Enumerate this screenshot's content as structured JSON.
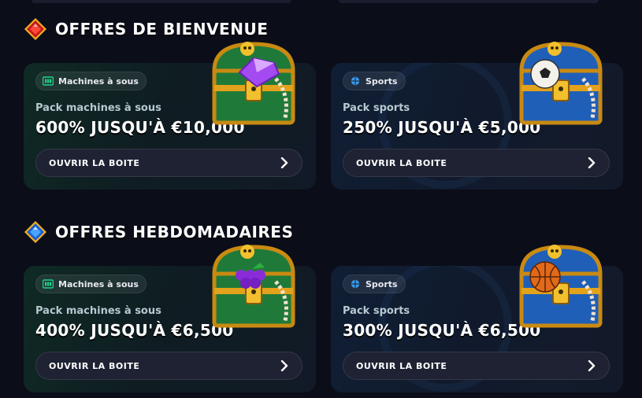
{
  "sections": [
    {
      "title": "OFFRES DE BIENVENUE",
      "gem_color": "red-gem-icon",
      "cards": [
        {
          "badge": "Machines à sous",
          "pack": "Pack machines à sous",
          "amount": "600% JUSQU'À €10,000",
          "cta": "OUVRIR LA BOITE",
          "chest": "purple-gem"
        },
        {
          "badge": "Sports",
          "pack": "Pack sports",
          "amount": "250% JUSQU'À €5,000",
          "cta": "OUVRIR LA BOITE",
          "chest": "soccer-ball"
        }
      ]
    },
    {
      "title": "OFFRES HEBDOMADAIRES",
      "gem_color": "blue-gem-icon",
      "cards": [
        {
          "badge": "Machines à sous",
          "pack": "Pack machines à sous",
          "amount": "400% JUSQU'À €6,500",
          "cta": "OUVRIR LA BOITE",
          "chest": "grapes"
        },
        {
          "badge": "Sports",
          "pack": "Pack sports",
          "amount": "300% JUSQU'À €6,500",
          "cta": "OUVRIR LA BOITE",
          "chest": "basketball"
        }
      ]
    }
  ],
  "colors": {
    "background": "#0b0d19",
    "slots_accent": "#1fd18a",
    "sports_accent": "#3a9be8",
    "button_bg": "#1f2233",
    "gold": "#e8a219"
  }
}
